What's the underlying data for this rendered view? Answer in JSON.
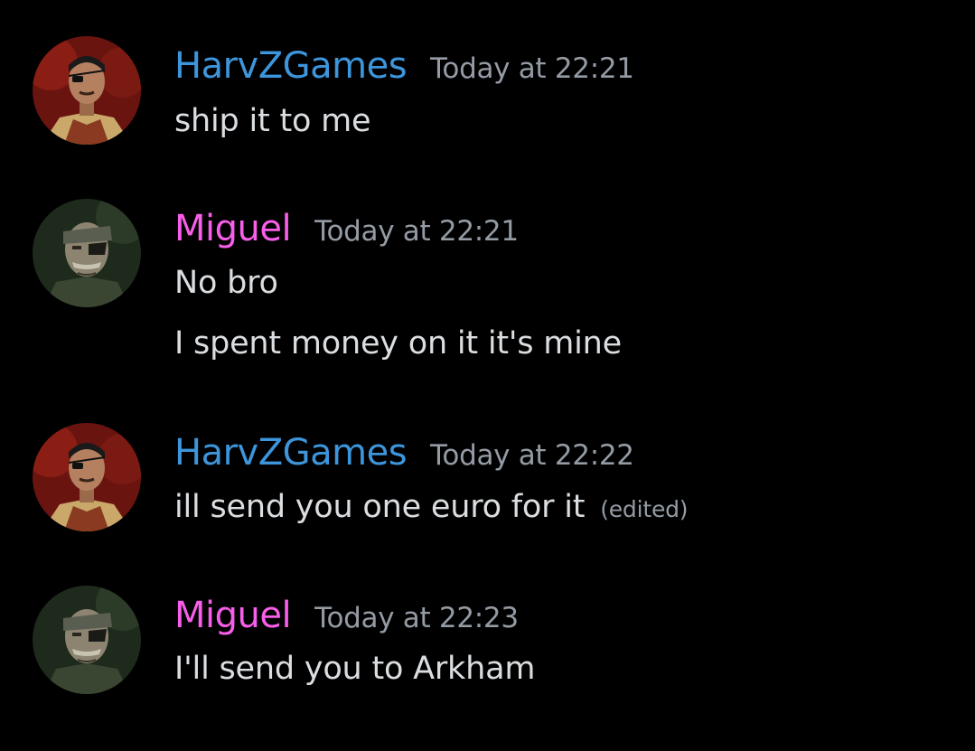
{
  "colors": {
    "background": "#000000",
    "harvz_name": "#3d95db",
    "miguel_name": "#f75ee9",
    "timestamp": "#949ba4",
    "message_text": "#dbdee1"
  },
  "messages": [
    {
      "author": "HarvZGames",
      "timestamp": "Today at 22:21",
      "avatar_icon": "harvz-avatar",
      "lines": [
        "ship it to me"
      ]
    },
    {
      "author": "Miguel",
      "timestamp": "Today at 22:21",
      "avatar_icon": "miguel-avatar",
      "lines": [
        "No bro",
        "I spent money on it it's mine"
      ]
    },
    {
      "author": "HarvZGames",
      "timestamp": "Today at 22:22",
      "avatar_icon": "harvz-avatar",
      "lines": [
        "ill send you one euro for it"
      ],
      "edited_label": "(edited)"
    },
    {
      "author": "Miguel",
      "timestamp": "Today at 22:23",
      "avatar_icon": "miguel-avatar",
      "lines": [
        "I'll send you to Arkham"
      ]
    }
  ]
}
